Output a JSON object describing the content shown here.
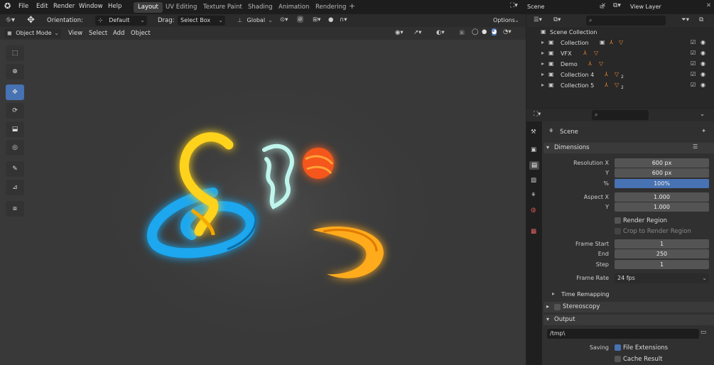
{
  "menu": {
    "file": "File",
    "edit": "Edit",
    "render": "Render",
    "window": "Window",
    "help": "Help"
  },
  "workspace_tabs": [
    "Layout",
    "UV Editing",
    "Texture Paint",
    "Shading",
    "Animation",
    "Rendering"
  ],
  "scene_field": "Scene",
  "view_layer_field": "View Layer",
  "header": {
    "orientation_label": "Orientation:",
    "orientation_value": "Default",
    "drag_label": "Drag:",
    "drag_value": "Select Box",
    "transform_value": "Global",
    "options": "Options"
  },
  "viewport_header": {
    "mode": "Object Mode",
    "view": "View",
    "select": "Select",
    "add": "Add",
    "object": "Object"
  },
  "outliner": {
    "root": "Scene Collection",
    "items": [
      {
        "name": "Collection"
      },
      {
        "name": "VFX"
      },
      {
        "name": "Demo"
      },
      {
        "name": "Collection 4",
        "badge": "2"
      },
      {
        "name": "Collection 5",
        "badge": "2"
      }
    ]
  },
  "properties": {
    "scene_name": "Scene",
    "dimensions_title": "Dimensions",
    "resolution_x_label": "Resolution X",
    "resolution_x": "600 px",
    "y_label": "Y",
    "resolution_y": "600 px",
    "percent_label": "%",
    "percent": "100%",
    "aspect_x_label": "Aspect X",
    "aspect_x": "1.000",
    "aspect_y_label": "Y",
    "aspect_y": "1.000",
    "render_region": "Render Region",
    "crop_region": "Crop to Render Region",
    "frame_start_label": "Frame Start",
    "frame_start": "1",
    "end_label": "End",
    "frame_end": "250",
    "step_label": "Step",
    "frame_step": "1",
    "frame_rate_label": "Frame Rate",
    "frame_rate": "24 fps",
    "time_remap": "Time Remapping",
    "stereoscopy": "Stereoscopy",
    "output_title": "Output",
    "output_path": "/tmp\\",
    "saving_label": "Saving",
    "file_ext": "File Extensions",
    "cache_result": "Cache Result"
  },
  "colors": {
    "accent": "#4772b3",
    "yellow": "#ffd21e",
    "blue": "#1aa7ef",
    "mint": "#bff5ec",
    "orange": "#ff8a1a",
    "red": "#f4561a"
  }
}
